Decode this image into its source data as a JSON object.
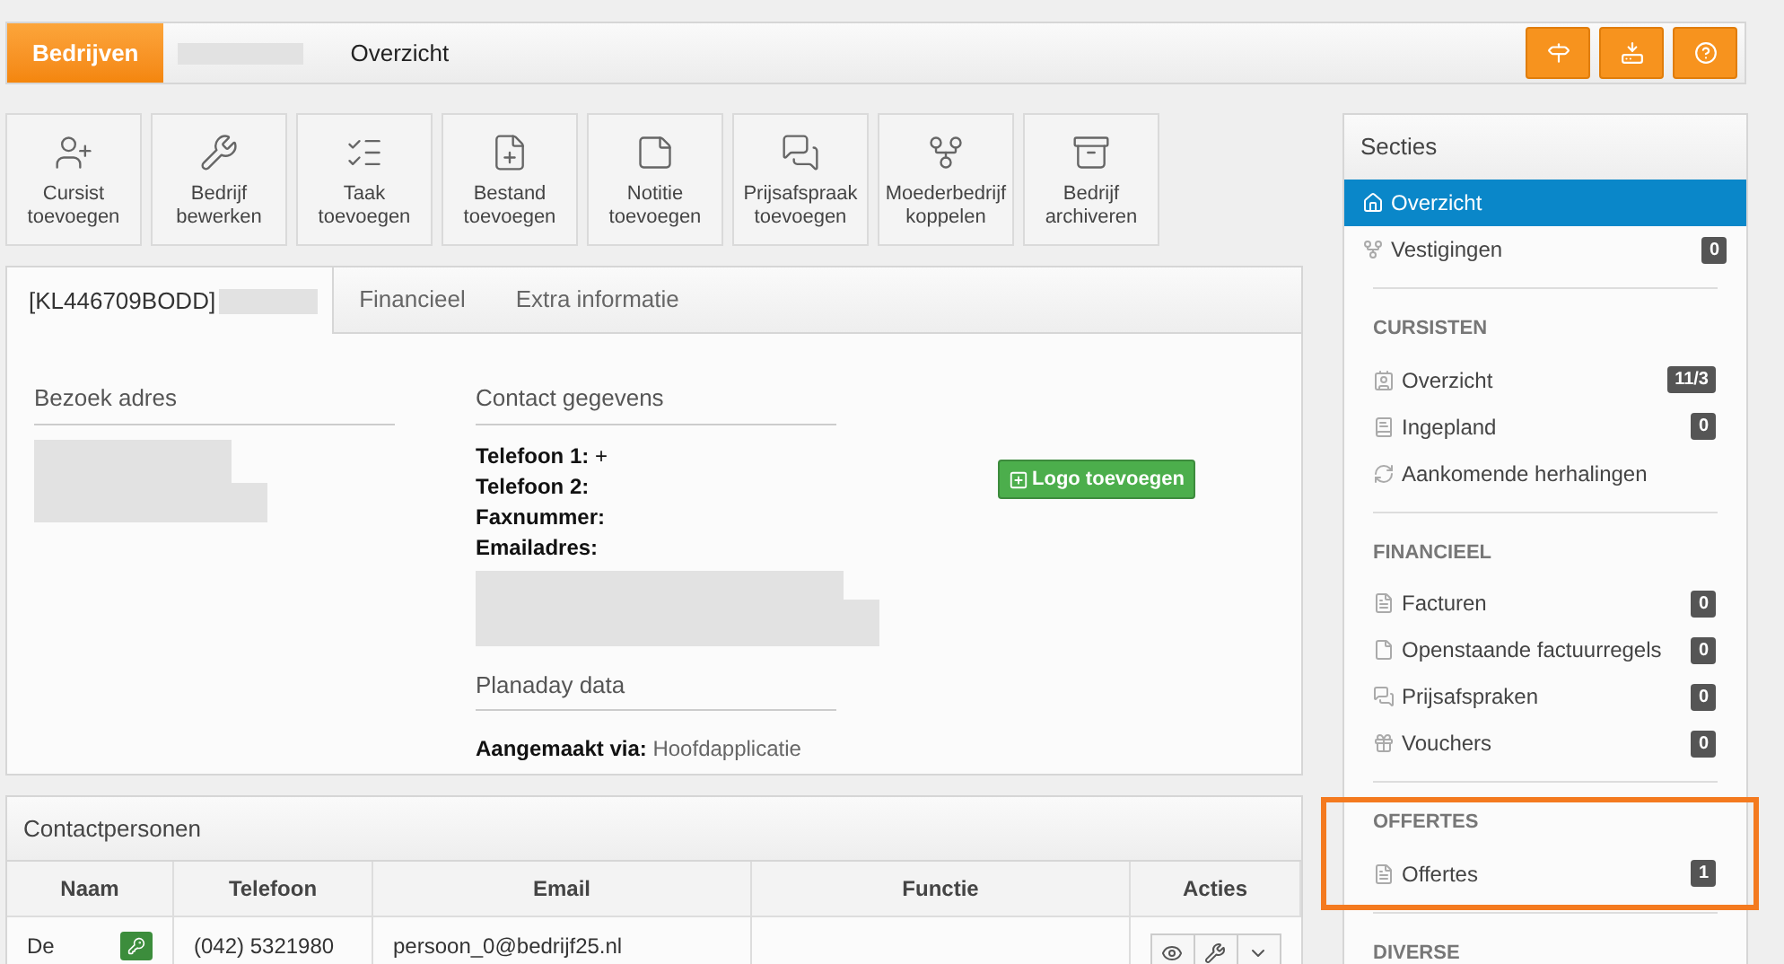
{
  "breadcrumb": [
    {
      "label": "Bedrijven",
      "selected": true
    },
    {
      "label": "Overzicht",
      "selected": false
    }
  ],
  "toolbar": [
    {
      "line1": "Cursist",
      "line2": "toevoegen"
    },
    {
      "line1": "Bedrijf",
      "line2": "bewerken"
    },
    {
      "line1": "Taak",
      "line2": "toevoegen"
    },
    {
      "line1": "Bestand",
      "line2": "toevoegen"
    },
    {
      "line1": "Notitie",
      "line2": "toevoegen"
    },
    {
      "line1": "Prijsafspraak",
      "line2": "toevoegen"
    },
    {
      "line1": "Moederbedrijf",
      "line2": "koppelen"
    },
    {
      "line1": "Bedrijf",
      "line2": "archiveren"
    }
  ],
  "tabs": [
    {
      "label": "[KL446709BODD]",
      "selected": true
    },
    {
      "label": "Financieel",
      "selected": false
    },
    {
      "label": "Extra informatie",
      "selected": false
    }
  ],
  "visit_address": {
    "heading": "Bezoek adres"
  },
  "contact": {
    "heading": "Contact gegevens",
    "fields": [
      {
        "label": "Telefoon 1:",
        "value": "+"
      },
      {
        "label": "Telefoon 2:"
      },
      {
        "label": "Faxnummer:"
      },
      {
        "label": "Emailadres:"
      }
    ]
  },
  "planaday": {
    "heading": "Planaday data",
    "label": "Aangemaakt via:",
    "value": "Hoofdapplicatie"
  },
  "logo_button": "Logo toevoegen",
  "contacts": {
    "title": "Contactpersonen",
    "columns": [
      "Naam",
      "Telefoon",
      "Email",
      "Functie",
      "Acties"
    ],
    "rows": [
      {
        "name": "De",
        "phone": "(042) 5321980",
        "email": "persoon_0@bedrijf25.nl"
      }
    ]
  },
  "sidebar": {
    "title": "Secties",
    "sections": [
      {
        "highlighted": false,
        "items": [
          {
            "label": "Overzicht",
            "selected": true
          },
          {
            "label": "Vestigingen",
            "count": "0",
            "selected": false
          }
        ]
      },
      {
        "heading": "CURSISTEN",
        "highlighted": false,
        "items": [
          {
            "label": "Overzicht",
            "count": "11/3",
            "selected": false
          },
          {
            "label": "Ingepland",
            "count": "0",
            "selected": false
          },
          {
            "label": "Aankomende herhalingen",
            "selected": false
          }
        ]
      },
      {
        "heading": "FINANCIEEL",
        "highlighted": false,
        "items": [
          {
            "label": "Facturen",
            "count": "0",
            "selected": false
          },
          {
            "label": "Openstaande factuurregels",
            "count": "0",
            "selected": false
          },
          {
            "label": "Prijsafspraken",
            "count": "0",
            "selected": false
          },
          {
            "label": "Vouchers",
            "count": "0",
            "selected": false
          }
        ]
      },
      {
        "heading": "OFFERTES",
        "highlighted": true,
        "items": [
          {
            "label": "Offertes",
            "count": "1",
            "selected": false
          }
        ]
      },
      {
        "heading": "DIVERSE",
        "highlighted": false
      }
    ]
  }
}
